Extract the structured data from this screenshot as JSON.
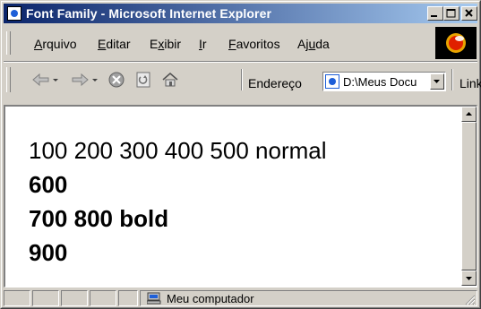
{
  "window": {
    "title": "Font Family - Microsoft Internet Explorer"
  },
  "menu": {
    "items": [
      {
        "pre": "",
        "key": "A",
        "post": "rquivo"
      },
      {
        "pre": "",
        "key": "E",
        "post": "ditar"
      },
      {
        "pre": "E",
        "key": "x",
        "post": "ibir"
      },
      {
        "pre": "",
        "key": "I",
        "post": "r"
      },
      {
        "pre": "",
        "key": "F",
        "post": "avoritos"
      },
      {
        "pre": "Aj",
        "key": "u",
        "post": "da"
      }
    ]
  },
  "toolbar": {
    "address_label": "Endereço",
    "address_value": "D:\\Meus Docu",
    "links_label": "Links"
  },
  "page": {
    "lines": [
      {
        "text": "100 200 300 400 500 normal",
        "weight": "normal"
      },
      {
        "text": "600",
        "weight": "bold"
      },
      {
        "text": "700 800 bold",
        "weight": "bold"
      },
      {
        "text": "900",
        "weight": "bold"
      }
    ]
  },
  "status": {
    "zone_text": "Meu computador"
  },
  "colors": {
    "title_start": "#0a246a",
    "title_end": "#a6caf0",
    "chrome": "#d4d0c8"
  },
  "icons": [
    "window-icon",
    "minimize-icon",
    "maximize-icon",
    "close-icon",
    "back-arrow-icon",
    "forward-arrow-icon",
    "stop-icon",
    "refresh-icon",
    "home-icon",
    "ie-logo-icon",
    "page-icon",
    "computer-icon"
  ]
}
